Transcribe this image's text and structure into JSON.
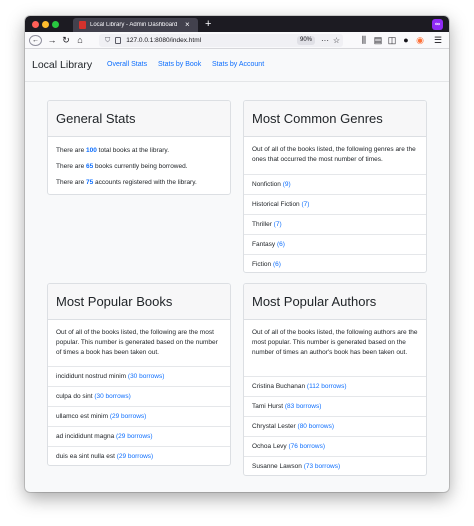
{
  "browser": {
    "tab_title": "Local Library - Admin Dashboard",
    "tab_close": "×",
    "new_tab": "+",
    "url": "127.0.0.1:8080/index.html",
    "zoom": "90%",
    "ext_badge": "∞"
  },
  "nav": {
    "brand": "Local Library",
    "links": [
      "Overall Stats",
      "Stats by Book",
      "Stats by Account"
    ]
  },
  "general_stats": {
    "title": "General Stats",
    "lines": [
      {
        "prefix": "There are ",
        "value": "100",
        "suffix": " total books at the library."
      },
      {
        "prefix": "There are ",
        "value": "65",
        "suffix": " books currently being borrowed."
      },
      {
        "prefix": "There are ",
        "value": "75",
        "suffix": " accounts registered with the library."
      }
    ]
  },
  "genres": {
    "title": "Most Common Genres",
    "description": "Out of all of the books listed, the following genres are the ones that occurred the most number of times.",
    "items": [
      {
        "name": "Nonfiction ",
        "count": "(9)"
      },
      {
        "name": "Historical Fiction ",
        "count": "(7)"
      },
      {
        "name": "Thriller ",
        "count": "(7)"
      },
      {
        "name": "Fantasy ",
        "count": "(6)"
      },
      {
        "name": "Fiction ",
        "count": "(6)"
      }
    ]
  },
  "books": {
    "title": "Most Popular Books",
    "description": "Out of all of the books listed, the following are the most popular. This number is generated based on the number of times a book has been taken out.",
    "items": [
      {
        "name": "incididunt nostrud minim ",
        "count": "(30 borrows)"
      },
      {
        "name": "culpa do sint ",
        "count": "(30 borrows)"
      },
      {
        "name": "ullamco est minim ",
        "count": "(29 borrows)"
      },
      {
        "name": "ad incididunt magna ",
        "count": "(29 borrows)"
      },
      {
        "name": "duis ea sint nulla est ",
        "count": "(29 borrows)"
      }
    ]
  },
  "authors": {
    "title": "Most Popular Authors",
    "description": "Out of all of the books listed, the following authors are the most popular. This number is generated based on the number of times an author's book has been taken out.",
    "items": [
      {
        "name": "Cristina Buchanan ",
        "count": "(112 borrows)"
      },
      {
        "name": "Tami Hurst ",
        "count": "(83 borrows)"
      },
      {
        "name": "Chrystal Lester ",
        "count": "(80 borrows)"
      },
      {
        "name": "Ochoa Levy ",
        "count": "(76 borrows)"
      },
      {
        "name": "Susanne Lawson ",
        "count": "(73 borrows)"
      }
    ]
  },
  "colors": {
    "link": "#0d6efd",
    "tab_bar": "#1c1b22",
    "traffic_red": "#ff5f57",
    "traffic_yellow": "#febc2e",
    "traffic_green": "#28c840"
  }
}
